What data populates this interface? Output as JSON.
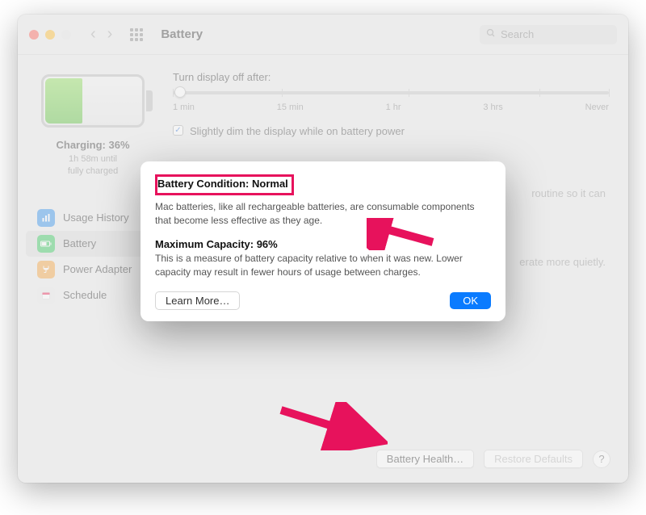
{
  "toolbar": {
    "title": "Battery",
    "search_placeholder": "Search"
  },
  "sidebar": {
    "battery_graphic_level_pct": 36,
    "charging_label": "Charging: 36%",
    "time_remaining_line1": "1h 58m until",
    "time_remaining_line2": "fully charged",
    "items": [
      {
        "label": "Usage History",
        "icon": "chart-icon",
        "color": "blue",
        "active": false
      },
      {
        "label": "Battery",
        "icon": "battery-icon",
        "color": "green",
        "active": true
      },
      {
        "label": "Power Adapter",
        "icon": "plug-icon",
        "color": "orange",
        "active": false
      },
      {
        "label": "Schedule",
        "icon": "calendar-icon",
        "color": "grey",
        "active": false
      }
    ]
  },
  "main": {
    "display_off_label": "Turn display off after:",
    "ticks": [
      "1 min",
      "15 min",
      "1 hr",
      "3 hrs",
      "Never"
    ],
    "opt_dim": "Slightly dim the display while on battery power",
    "opt_auto_switch_fragment": "routine so it can",
    "opt_quiet_fragment": "erate more quietly.",
    "battery_health_btn": "Battery Health…",
    "restore_defaults_btn": "Restore Defaults"
  },
  "sheet": {
    "condition_label": "Battery Condition: Normal",
    "condition_desc": "Mac batteries, like all rechargeable batteries, are consumable components that become less effective as they age.",
    "capacity_label": "Maximum Capacity: 96%",
    "capacity_desc": "This is a measure of battery capacity relative to when it was new. Lower capacity may result in fewer hours of usage between charges.",
    "learn_more_btn": "Learn More…",
    "ok_btn": "OK"
  },
  "annotation_color": "#e7125c"
}
